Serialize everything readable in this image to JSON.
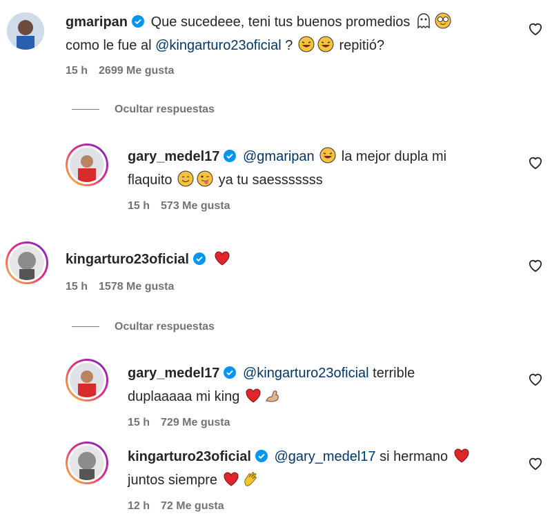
{
  "comments": [
    {
      "user": "gmaripan",
      "text_1": "Que sucedeee, teni tus buenos promedios",
      "text_2": "como le fue al",
      "mention": "@kingarturo23oficial",
      "text_3": "?",
      "text_4": "repitió?",
      "time": "15 h",
      "likes": "2699 Me gusta"
    },
    {
      "user": "gary_medel17",
      "mention": "@gmaripan",
      "text_1": "la mejor dupla mi",
      "text_2": "flaquito",
      "text_3": "ya tu saesssssss",
      "time": "15 h",
      "likes": "573 Me gusta"
    },
    {
      "user": "kingarturo23oficial",
      "time": "15 h",
      "likes": "1578 Me gusta"
    },
    {
      "user": "gary_medel17",
      "mention": "@kingarturo23oficial",
      "text_1": "terrible",
      "text_2": "duplaaaaa mi king",
      "time": "15 h",
      "likes": "729 Me gusta"
    },
    {
      "user": "kingarturo23oficial",
      "mention": "@gary_medel17",
      "text_1": "si hermano",
      "text_2": "juntos siempre",
      "time": "12 h",
      "likes": "72 Me gusta"
    }
  ],
  "hide_replies_label": "Ocultar respuestas",
  "colors": {
    "verified": "#0095f6",
    "heart_red": "#e0262b",
    "mention": "#00376b",
    "meta": "#737373"
  },
  "icons": [
    "verified-badge-icon",
    "like-heart-icon",
    "red-heart-emoji",
    "flexed-bicep-emoji",
    "waving-hand-emoji",
    "laughing-emoji",
    "ghost-emoji",
    "sunglasses-emoji",
    "smiling-emoji",
    "winking-tongue-emoji"
  ]
}
